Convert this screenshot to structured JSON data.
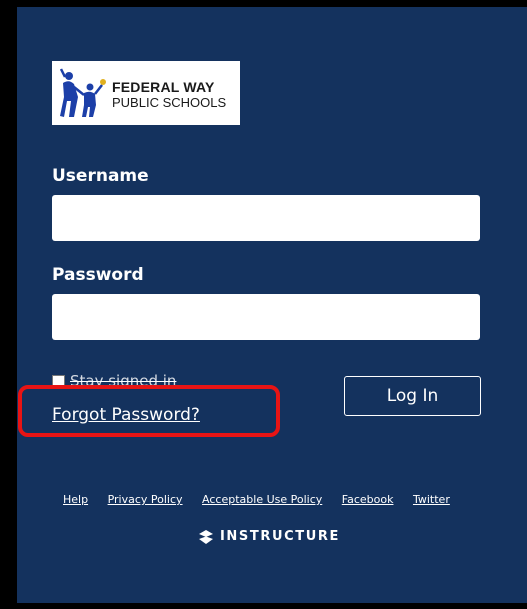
{
  "branding": {
    "logo_line1": "FEDERAL WAY",
    "logo_line2": "PUBLIC SCHOOLS",
    "vendor": "INSTRUCTURE",
    "vendor_icon": "instructure-logo-icon"
  },
  "login_form": {
    "username_label": "Username",
    "username_value": "",
    "password_label": "Password",
    "password_value": "",
    "stay_signed_in_label": "Stay signed in",
    "stay_signed_in_checked": false,
    "forgot_password_label": "Forgot Password?",
    "login_button_label": "Log In"
  },
  "footer": {
    "links": [
      "Help",
      "Privacy Policy",
      "Acceptable Use Policy",
      "Facebook",
      "Twitter"
    ]
  },
  "colors": {
    "panel_background": "#14325e",
    "highlight": "#e81414",
    "text": "#ffffff"
  }
}
